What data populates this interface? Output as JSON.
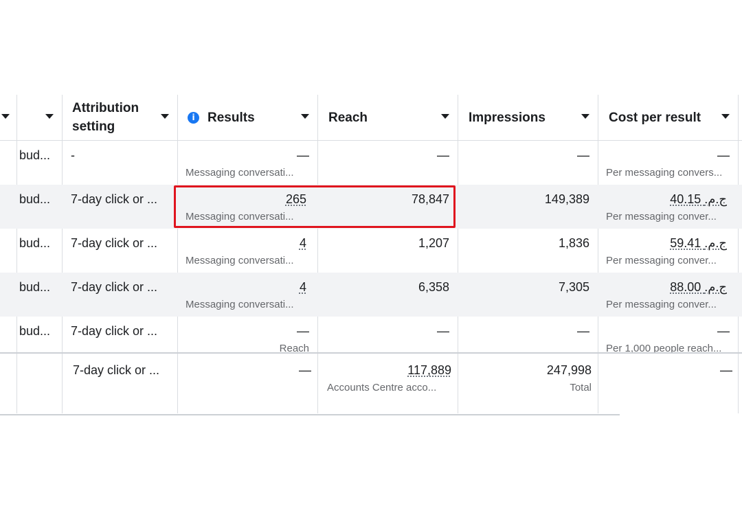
{
  "columns": {
    "attribution": "Attribution setting",
    "results": "Results",
    "reach": "Reach",
    "impressions": "Impressions",
    "cost_per_result": "Cost per result"
  },
  "rows": [
    {
      "budget": "bud...",
      "attribution": "-",
      "results": "—",
      "results_sub": "Messaging conversati...",
      "reach": "—",
      "impressions": "—",
      "cost": "—",
      "cost_sub": "Per messaging convers..."
    },
    {
      "budget": "bud...",
      "attribution": "7-day click or ...",
      "results": "265",
      "results_sub": "Messaging conversati...",
      "reach": "78,847",
      "impressions": "149,389",
      "cost": "40.15 ج.م.‏",
      "cost_sub": "Per messaging conver..."
    },
    {
      "budget": "bud...",
      "attribution": "7-day click or ...",
      "results": "4",
      "results_sub": "Messaging conversati...",
      "reach": "1,207",
      "impressions": "1,836",
      "cost": "59.41 ج.م.‏",
      "cost_sub": "Per messaging conver..."
    },
    {
      "budget": "bud...",
      "attribution": "7-day click or ...",
      "results": "4",
      "results_sub": "Messaging conversati...",
      "reach": "6,358",
      "impressions": "7,305",
      "cost": "88.00 ج.م.‏",
      "cost_sub": "Per messaging conver..."
    },
    {
      "budget": "bud...",
      "attribution": "7-day click or ...",
      "results": "—",
      "results_sub": "Reach",
      "reach": "—",
      "impressions": "—",
      "cost": "—",
      "cost_sub": "Per 1,000 people reach..."
    }
  ],
  "totals": {
    "attribution": "7-day click or ...",
    "results": "—",
    "reach": "117,889",
    "reach_sub": "Accounts Centre acco...",
    "impressions": "247,998",
    "impressions_sub": "Total",
    "cost": "—"
  },
  "colors": {
    "highlight": "#e0141e",
    "info": "#1877f2",
    "row_shade": "#f2f3f5"
  },
  "icons": {
    "info": "info-icon",
    "dropdown": "caret-down-icon"
  }
}
